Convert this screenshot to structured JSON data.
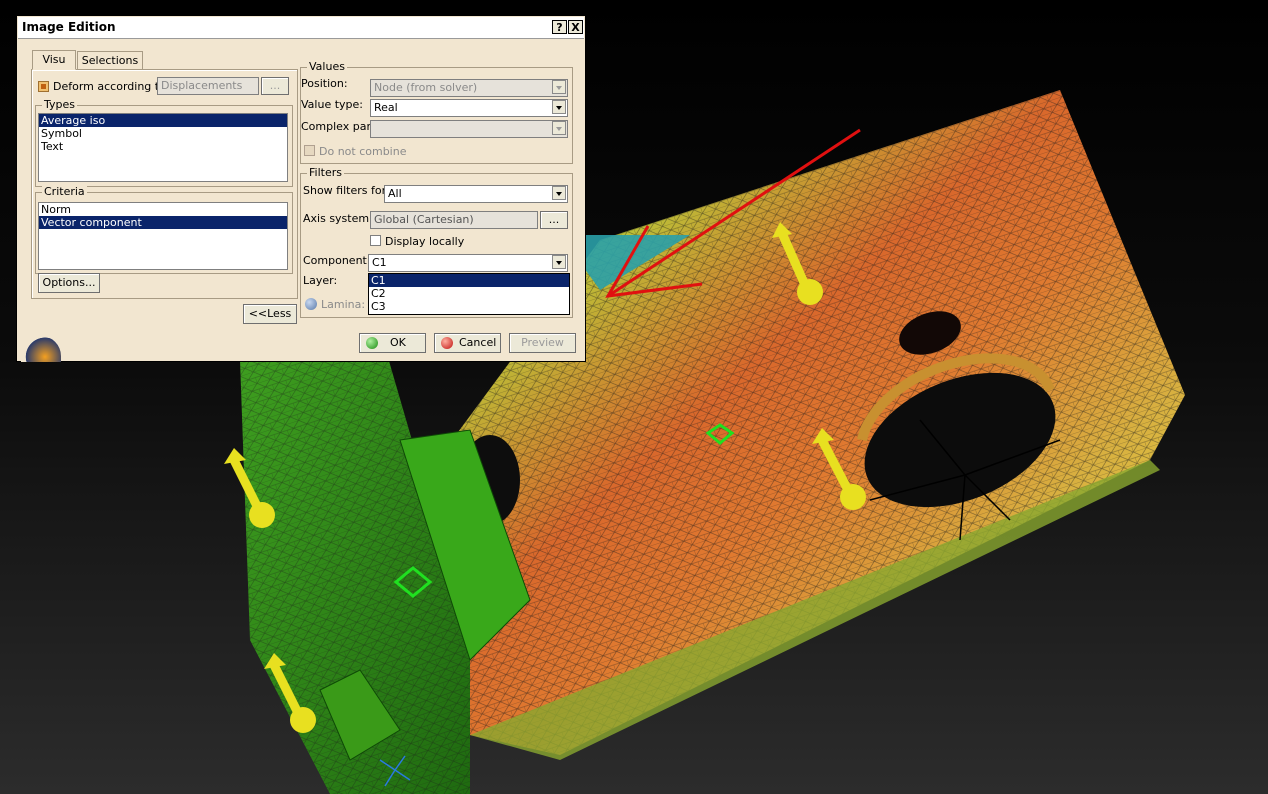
{
  "dialog": {
    "title": "Image Edition",
    "help_label": "?",
    "close_label": "X",
    "tabs": [
      {
        "label": "Visu"
      },
      {
        "label": "Selections"
      }
    ],
    "deform": {
      "label": "Deform according to",
      "value": "Displacements",
      "browse_label": "..."
    },
    "types": {
      "legend": "Types",
      "items": [
        "Average iso",
        "Symbol",
        "Text"
      ],
      "selected": "Average iso"
    },
    "criteria": {
      "legend": "Criteria",
      "items": [
        "Norm",
        "Vector component"
      ],
      "selected": "Vector component"
    },
    "options_label": "Options...",
    "less_label": "<<Less",
    "values": {
      "legend": "Values",
      "position_label": "Position:",
      "position_value": "Node (from solver)",
      "value_type_label": "Value type:",
      "value_type_value": "Real",
      "complex_part_label": "Complex part:",
      "complex_part_value": "",
      "do_not_combine_label": "Do not combine"
    },
    "filters": {
      "legend": "Filters",
      "show_filters_label": "Show filters for:",
      "show_filters_value": "All",
      "axis_label": "Axis system:",
      "axis_value": "Global (Cartesian)",
      "axis_browse_label": "...",
      "display_locally_label": "Display locally",
      "component_label": "Component:",
      "component_value": "C1",
      "component_options": [
        "C1",
        "C2",
        "C3"
      ],
      "layer_label": "Layer:",
      "lamina_label": "Lamina:"
    },
    "ok_label": "OK",
    "cancel_label": "Cancel",
    "preview_label": "Preview"
  },
  "colors": {
    "dialog_bg": "#f2e6d0",
    "selection": "#0a246a",
    "annotation_arrow": "#e01010",
    "load_arrow": "#e8e020",
    "mesh_hot": "#e05020",
    "mesh_mid": "#d0b030",
    "mesh_cool": "#40c020"
  },
  "icons": [
    "question-icon",
    "close-icon",
    "ok-green-ball-icon",
    "cancel-red-ball-icon",
    "lamina-ball-icon",
    "chevron-down-icon",
    "red-annotation-arrow",
    "yellow-load-arrow-icon",
    "green-node-marker-icon"
  ]
}
